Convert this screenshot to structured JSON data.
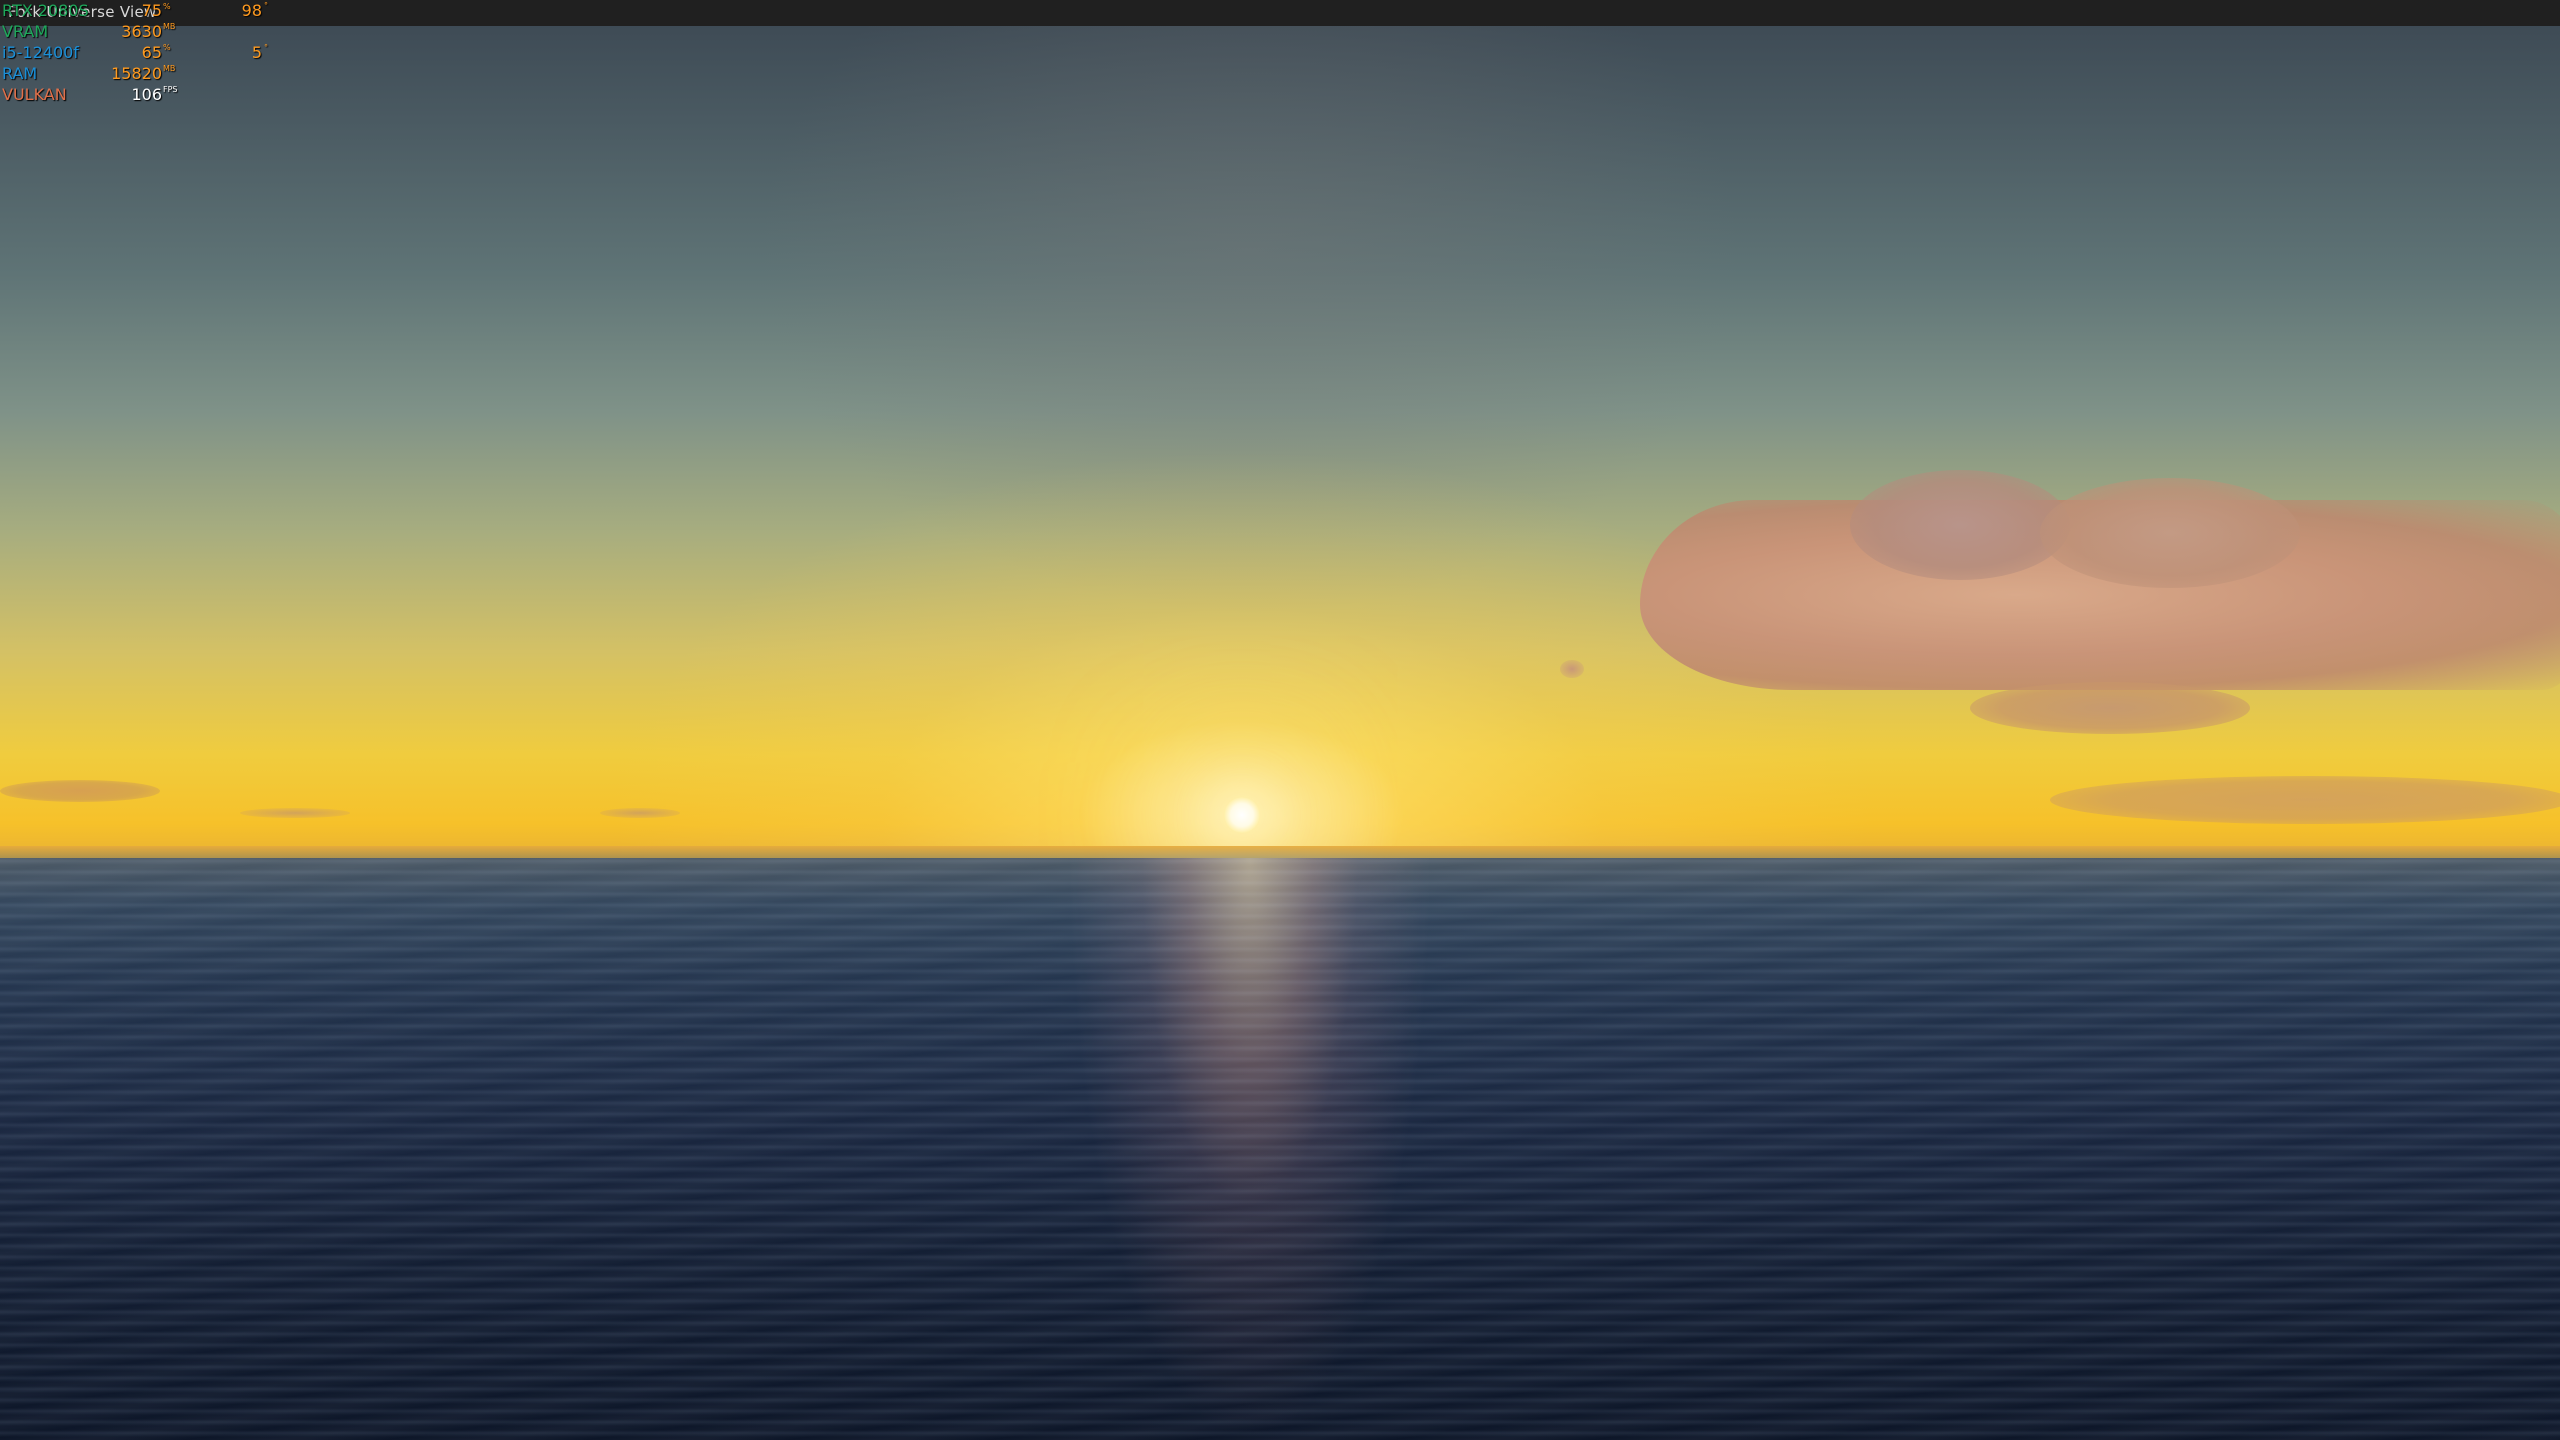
{
  "window": {
    "title": "Fork Universe View"
  },
  "overlay": {
    "colors": {
      "gpu": "#1ea85a",
      "vram": "#1ea85a",
      "cpu": "#1a8fd8",
      "ram": "#1a8fd8",
      "api": "#e0704a",
      "value": "#ff9a1f",
      "fps": "#ffffff"
    },
    "rows": [
      {
        "label": "RTX 2080S",
        "value": "75",
        "unit": "%",
        "value2": "98",
        "unit2": "°"
      },
      {
        "label": "VRAM",
        "value": "3630",
        "unit": "MB"
      },
      {
        "label": "i5-12400f",
        "value": "65",
        "unit": "%",
        "value2": "5",
        "unit2": "°"
      },
      {
        "label": "RAM",
        "value": "15820",
        "unit": "MB"
      },
      {
        "label": "VULKAN",
        "value": "106",
        "unit": "FPS"
      }
    ]
  }
}
